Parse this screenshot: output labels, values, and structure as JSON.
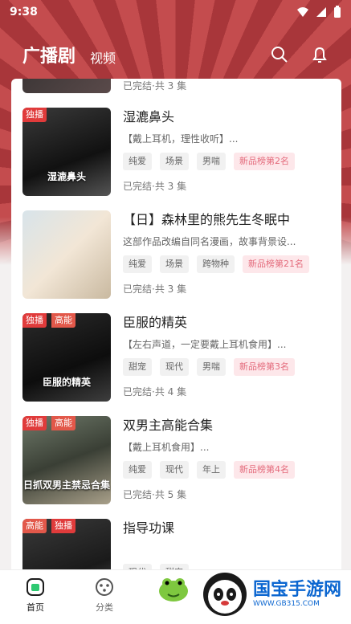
{
  "status_bar": {
    "time": "9:38"
  },
  "header": {
    "tab_main": "广播剧",
    "tab_video": "视频"
  },
  "list": [
    {
      "title": "",
      "desc": "",
      "tags": [],
      "status": "已完结·共 3 集",
      "badges": [],
      "cover_text": ""
    },
    {
      "title": "湿漉鼻头",
      "desc": "【戴上耳机，理性收听】...",
      "tags": [
        "纯爱",
        "场景",
        "男喘"
      ],
      "rank": "新品榜第2名",
      "status": "已完结·共 3 集",
      "badges": [
        "独播"
      ],
      "cover_text": "湿漉鼻头"
    },
    {
      "title": "【日】森林里的熊先生冬眠中",
      "desc": "这部作品改编自同名漫画，故事背景设...",
      "tags": [
        "纯爱",
        "场景",
        "跨物种"
      ],
      "rank": "新品榜第21名",
      "status": "已完结·共 3 集",
      "badges": [],
      "cover_text": ""
    },
    {
      "title": "臣服的精英",
      "desc": "【左右声道，一定要戴上耳机食用】...",
      "tags": [
        "甜宠",
        "现代",
        "男喘"
      ],
      "rank": "新品榜第3名",
      "status": "已完结·共 4 集",
      "badges": [
        "独播",
        "高能"
      ],
      "cover_text": "臣服的精英"
    },
    {
      "title": "双男主高能合集",
      "desc": "【戴上耳机食用】...",
      "tags": [
        "纯爱",
        "现代",
        "年上"
      ],
      "rank": "新品榜第4名",
      "status": "已完结·共 5 集",
      "badges": [
        "独播",
        "高能"
      ],
      "cover_text": "日抓双男主禁忌合集"
    },
    {
      "title": "指导功课",
      "desc": "",
      "tags": [
        "现代",
        "甜宠"
      ],
      "rank": "",
      "status": "",
      "badges": [
        "高能",
        "独播"
      ],
      "cover_text": ""
    }
  ],
  "nav": {
    "home": "首页",
    "category": "分类"
  },
  "watermark": {
    "main": "国宝手游网",
    "sub": "WWW.GB315.COM"
  }
}
